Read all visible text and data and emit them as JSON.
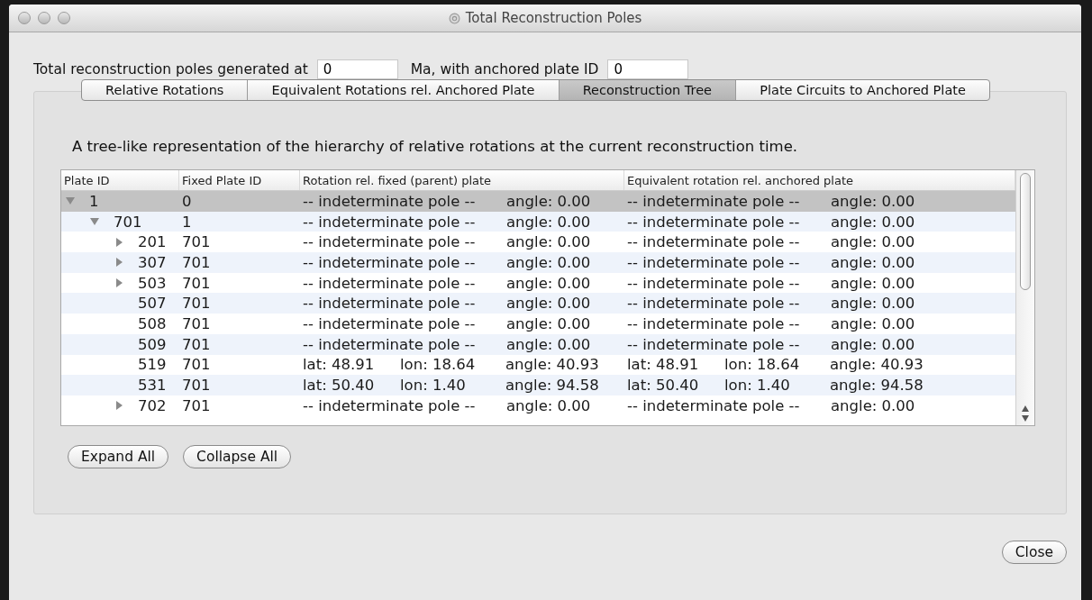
{
  "window": {
    "title": "Total Reconstruction Poles"
  },
  "header": {
    "prefix": "Total reconstruction poles generated at",
    "time_value": "0",
    "middle": "Ma, with anchored plate ID",
    "plate_value": "0"
  },
  "tabs": [
    {
      "label": "Relative Rotations",
      "selected": false
    },
    {
      "label": "Equivalent Rotations rel. Anchored Plate",
      "selected": false
    },
    {
      "label": "Reconstruction Tree",
      "selected": true
    },
    {
      "label": "Plate Circuits to Anchored Plate",
      "selected": false
    }
  ],
  "description": "A tree-like representation of the hierarchy of relative rotations at the current reconstruction time.",
  "table": {
    "columns": [
      "Plate ID",
      "Fixed Plate ID",
      "Rotation rel. fixed (parent) plate",
      "Equivalent rotation rel. anchored plate"
    ],
    "rows": [
      {
        "plate_id": "1",
        "fixed_plate_id": "0",
        "selected": true,
        "expanded": true,
        "rotation": {
          "kind": "indeterminate",
          "pole": "-- indeterminate pole --",
          "angle": "angle: 0.00"
        },
        "equivalent": {
          "kind": "indeterminate",
          "pole": "-- indeterminate pole --",
          "angle": "angle: 0.00"
        },
        "children": [
          {
            "plate_id": "701",
            "fixed_plate_id": "1",
            "selected": false,
            "expanded": true,
            "rotation": {
              "kind": "indeterminate",
              "pole": "-- indeterminate pole --",
              "angle": "angle: 0.00"
            },
            "equivalent": {
              "kind": "indeterminate",
              "pole": "-- indeterminate pole --",
              "angle": "angle: 0.00"
            },
            "children": [
              {
                "plate_id": "201",
                "fixed_plate_id": "701",
                "selected": false,
                "expanded": false,
                "rotation": {
                  "kind": "indeterminate",
                  "pole": "-- indeterminate pole --",
                  "angle": "angle: 0.00"
                },
                "equivalent": {
                  "kind": "indeterminate",
                  "pole": "-- indeterminate pole --",
                  "angle": "angle: 0.00"
                }
              },
              {
                "plate_id": "307",
                "fixed_plate_id": "701",
                "selected": false,
                "expanded": false,
                "rotation": {
                  "kind": "indeterminate",
                  "pole": "-- indeterminate pole --",
                  "angle": "angle: 0.00"
                },
                "equivalent": {
                  "kind": "indeterminate",
                  "pole": "-- indeterminate pole --",
                  "angle": "angle: 0.00"
                }
              },
              {
                "plate_id": "503",
                "fixed_plate_id": "701",
                "selected": false,
                "expanded": false,
                "rotation": {
                  "kind": "indeterminate",
                  "pole": "-- indeterminate pole --",
                  "angle": "angle: 0.00"
                },
                "equivalent": {
                  "kind": "indeterminate",
                  "pole": "-- indeterminate pole --",
                  "angle": "angle: 0.00"
                }
              },
              {
                "plate_id": "507",
                "fixed_plate_id": "701",
                "selected": false,
                "rotation": {
                  "kind": "indeterminate",
                  "pole": "-- indeterminate pole --",
                  "angle": "angle: 0.00"
                },
                "equivalent": {
                  "kind": "indeterminate",
                  "pole": "-- indeterminate pole --",
                  "angle": "angle: 0.00"
                }
              },
              {
                "plate_id": "508",
                "fixed_plate_id": "701",
                "selected": false,
                "rotation": {
                  "kind": "indeterminate",
                  "pole": "-- indeterminate pole --",
                  "angle": "angle: 0.00"
                },
                "equivalent": {
                  "kind": "indeterminate",
                  "pole": "-- indeterminate pole --",
                  "angle": "angle: 0.00"
                }
              },
              {
                "plate_id": "509",
                "fixed_plate_id": "701",
                "selected": false,
                "rotation": {
                  "kind": "indeterminate",
                  "pole": "-- indeterminate pole --",
                  "angle": "angle: 0.00"
                },
                "equivalent": {
                  "kind": "indeterminate",
                  "pole": "-- indeterminate pole --",
                  "angle": "angle: 0.00"
                }
              },
              {
                "plate_id": "519",
                "fixed_plate_id": "701",
                "selected": false,
                "rotation": {
                  "kind": "pole",
                  "lat": "lat: 48.91",
                  "lon": "lon: 18.64",
                  "angle": "angle: 40.93"
                },
                "equivalent": {
                  "kind": "pole",
                  "lat": "lat: 48.91",
                  "lon": "lon: 18.64",
                  "angle": "angle: 40.93"
                }
              },
              {
                "plate_id": "531",
                "fixed_plate_id": "701",
                "selected": false,
                "rotation": {
                  "kind": "pole",
                  "lat": "lat: 50.40",
                  "lon": "lon: 1.40",
                  "angle": "angle: 94.58"
                },
                "equivalent": {
                  "kind": "pole",
                  "lat": "lat: 50.40",
                  "lon": "lon: 1.40",
                  "angle": "angle: 94.58"
                }
              },
              {
                "plate_id": "702",
                "fixed_plate_id": "701",
                "selected": false,
                "expanded": false,
                "rotation": {
                  "kind": "indeterminate",
                  "pole": "-- indeterminate pole --",
                  "angle": "angle: 0.00"
                },
                "equivalent": {
                  "kind": "indeterminate",
                  "pole": "-- indeterminate pole --",
                  "angle": "angle: 0.00"
                }
              }
            ]
          }
        ]
      }
    ]
  },
  "tree_buttons": [
    "Expand All",
    "Collapse All"
  ],
  "close_button": "Close"
}
